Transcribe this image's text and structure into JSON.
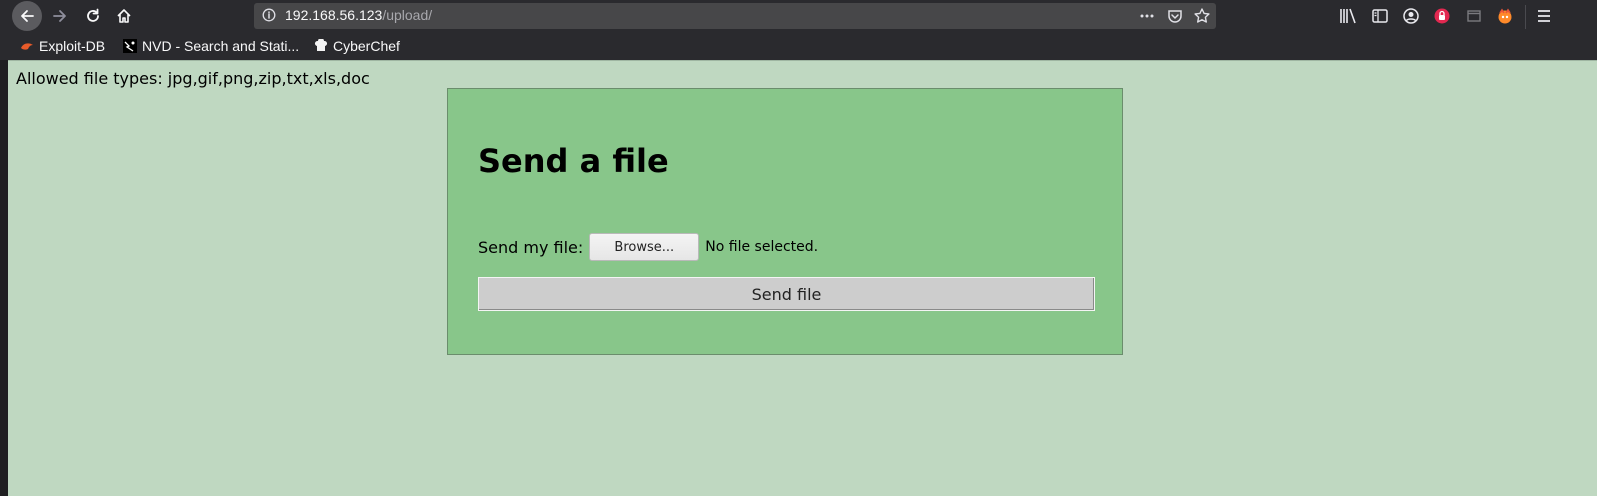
{
  "browser": {
    "url_host": "192.168.56.123",
    "url_path": "/upload/",
    "icons": [
      "back-arrow-icon",
      "forward-arrow-icon",
      "reload-icon",
      "home-icon",
      "info-icon",
      "page-actions-icon",
      "pocket-icon",
      "bookmark-star-icon",
      "library-icon",
      "sidebar-icon",
      "account-icon",
      "extension-shield-icon",
      "window-icon",
      "firefox-extension-icon",
      "menu-icon"
    ]
  },
  "bookmarks": [
    {
      "label": "Exploit-DB",
      "icon": "exploit-db-icon"
    },
    {
      "label": "NVD - Search and Stati...",
      "icon": "nvd-icon"
    },
    {
      "label": "CyberChef",
      "icon": "cyberchef-icon"
    }
  ],
  "page": {
    "allowed_text": "Allowed file types: jpg,gif,png,zip,txt,xls,doc",
    "heading": "Send a file",
    "file_label": "Send my file:",
    "browse_label": "Browse...",
    "file_status": "No file selected.",
    "send_label": "Send file"
  },
  "colors": {
    "page_background": "#bfd8c1",
    "card_background": "#88c68a",
    "chrome": "#2a2a2e"
  }
}
